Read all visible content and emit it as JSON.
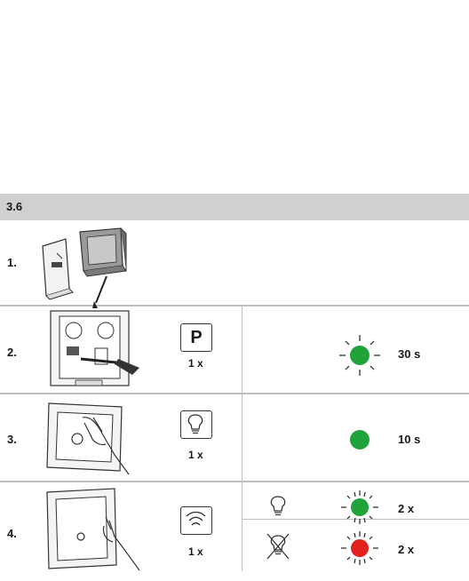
{
  "section": {
    "title": "3.6"
  },
  "steps": [
    {
      "number": "1."
    },
    {
      "number": "2.",
      "button": "P",
      "presses": "1 x",
      "led": "green-blinking",
      "duration": "30 s"
    },
    {
      "number": "3.",
      "button_icon": "bulb-icon",
      "presses": "1 x",
      "led": "green-steady",
      "duration": "10 s"
    },
    {
      "number": "4.",
      "button_icon": "wireless-icon",
      "presses": "1 x",
      "results": [
        {
          "condition_icon": "bulb-icon",
          "led": "green-blinking",
          "count": "2 x"
        },
        {
          "condition_icon": "bulb-crossed-icon",
          "led": "red-blinking",
          "count": "2 x"
        }
      ]
    }
  ],
  "colors": {
    "header": "#d0d0d0",
    "green_led": "#1fa33a",
    "red_led": "#e3201b",
    "divider": "#bfbfbf"
  }
}
